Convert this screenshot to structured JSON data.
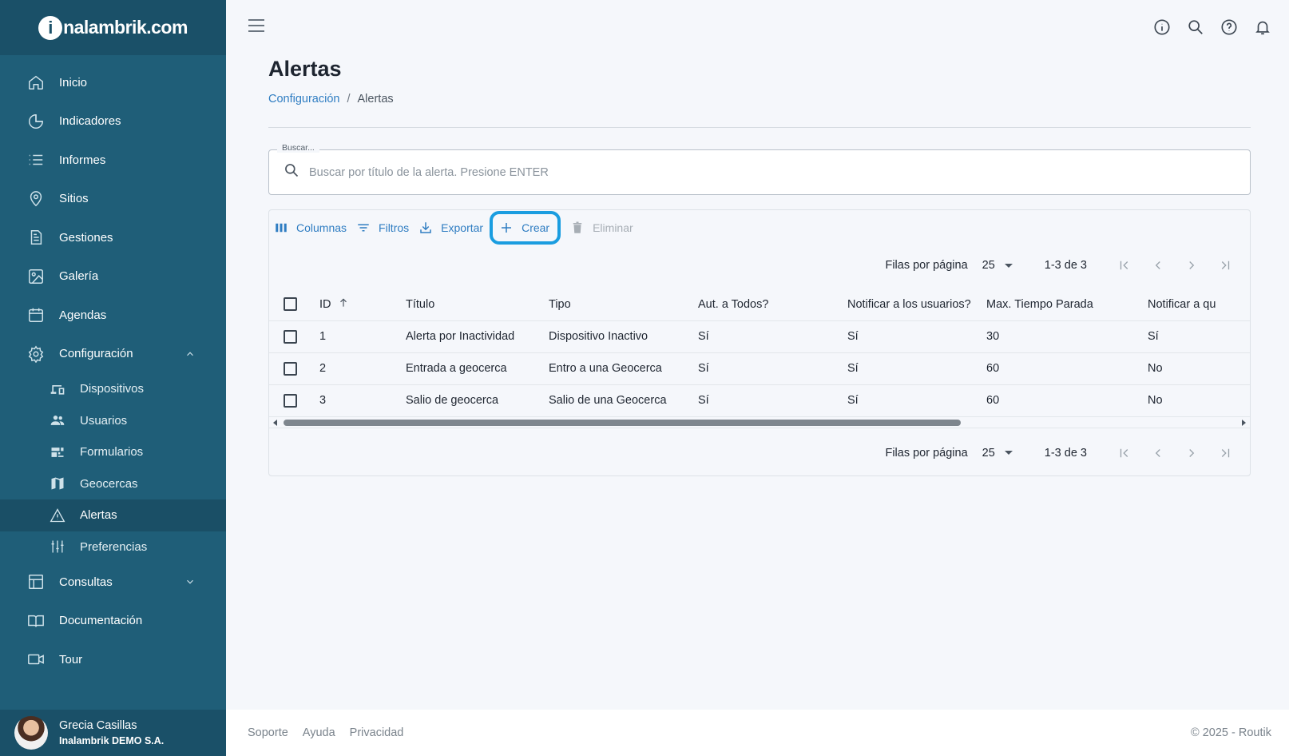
{
  "brand": {
    "logo_mark": "i",
    "logo_text": "nalambrik.com"
  },
  "sidebar": {
    "items": [
      {
        "label": "Inicio",
        "icon": "home-icon"
      },
      {
        "label": "Indicadores",
        "icon": "pie-chart-icon"
      },
      {
        "label": "Informes",
        "icon": "list-icon"
      },
      {
        "label": "Sitios",
        "icon": "location-pin-icon"
      },
      {
        "label": "Gestiones",
        "icon": "document-icon"
      },
      {
        "label": "Galería",
        "icon": "image-icon"
      },
      {
        "label": "Agendas",
        "icon": "calendar-icon"
      },
      {
        "label": "Configuración",
        "icon": "gear-icon",
        "expanded": true
      },
      {
        "label": "Consultas",
        "icon": "table-icon",
        "expanded": false
      },
      {
        "label": "Documentación",
        "icon": "book-icon"
      },
      {
        "label": "Tour",
        "icon": "video-icon"
      }
    ],
    "config_sub": [
      {
        "label": "Dispositivos",
        "icon": "devices-icon"
      },
      {
        "label": "Usuarios",
        "icon": "users-icon"
      },
      {
        "label": "Formularios",
        "icon": "forms-icon"
      },
      {
        "label": "Geocercas",
        "icon": "map-icon"
      },
      {
        "label": "Alertas",
        "icon": "warning-icon",
        "active": true
      },
      {
        "label": "Preferencias",
        "icon": "sliders-icon"
      }
    ],
    "user": {
      "name": "Grecia Casillas",
      "org": "Inalambrik DEMO S.A."
    }
  },
  "header": {
    "icons": [
      "info-icon",
      "search-icon",
      "help-icon",
      "bell-icon"
    ]
  },
  "page": {
    "title": "Alertas",
    "breadcrumb": {
      "parent": "Configuración",
      "separator": "/",
      "current": "Alertas"
    }
  },
  "search": {
    "legend": "Buscar...",
    "placeholder": "Buscar por título de la alerta. Presione ENTER"
  },
  "toolbar": {
    "columns": "Columnas",
    "filters": "Filtros",
    "export": "Exportar",
    "create": "Crear",
    "delete": "Eliminar"
  },
  "pager": {
    "rows_label": "Filas por página",
    "rows_value": "25",
    "range": "1-3 de 3"
  },
  "table": {
    "headers": [
      "ID",
      "Título",
      "Tipo",
      "Aut. a Todos?",
      "Notificar a los usuarios?",
      "Max. Tiempo Parada",
      "Notificar a quién?"
    ],
    "header_clipped": "Notificar a qu",
    "rows": [
      [
        "1",
        "Alerta por Inactividad",
        "Dispositivo Inactivo",
        "Sí",
        "Sí",
        "30",
        "Sí"
      ],
      [
        "2",
        "Entrada a geocerca",
        "Entro a una Geocerca",
        "Sí",
        "Sí",
        "60",
        "No"
      ],
      [
        "3",
        "Salio de geocerca",
        "Salio de una Geocerca",
        "Sí",
        "Sí",
        "60",
        "No"
      ]
    ]
  },
  "footer": {
    "links": [
      "Soporte",
      "Ayuda",
      "Privacidad"
    ],
    "copyright": "© 2025 - Routik"
  },
  "colors": {
    "sidebar": "#1f5e78",
    "accent": "#2f7dc2",
    "highlight": "#1a9de0"
  }
}
